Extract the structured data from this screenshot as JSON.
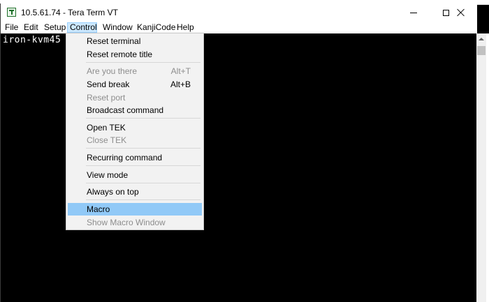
{
  "window": {
    "title": "10.5.61.74 - Tera Term VT"
  },
  "menubar": {
    "items": [
      "File",
      "Edit",
      "Setup",
      "Control",
      "Window",
      "KanjiCode",
      "Help"
    ],
    "active": "Control"
  },
  "terminal": {
    "line1": "iron-kvm45"
  },
  "control_menu": {
    "reset_terminal": "Reset terminal",
    "reset_remote_title": "Reset remote title",
    "are_you_there": "Are you there",
    "are_you_there_shortcut": "Alt+T",
    "send_break": "Send break",
    "send_break_shortcut": "Alt+B",
    "reset_port": "Reset port",
    "broadcast_command": "Broadcast command",
    "open_tek": "Open TEK",
    "close_tek": "Close TEK",
    "recurring_command": "Recurring command",
    "view_mode": "View mode",
    "always_on_top": "Always on top",
    "macro": "Macro",
    "show_macro_window": "Show Macro Window"
  },
  "colors": {
    "highlight": "#91c9f7",
    "active_menu": "#cce8ff",
    "terminal_bg": "#000000",
    "terminal_fg": "#ffffff"
  }
}
